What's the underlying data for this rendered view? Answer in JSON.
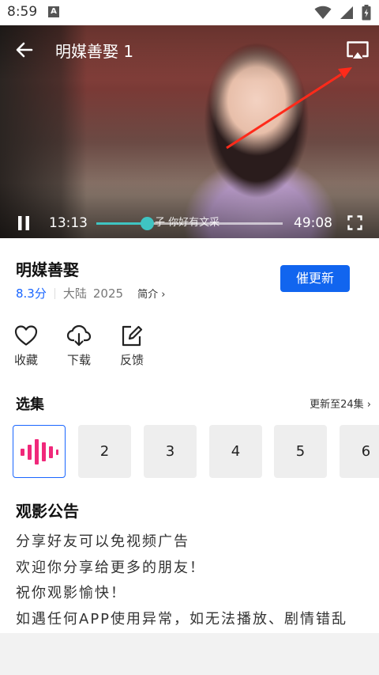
{
  "status_bar": {
    "time": "8:59",
    "notification_icon": "A",
    "icons": [
      "wifi-icon",
      "signal-icon",
      "battery-charging-icon"
    ]
  },
  "player": {
    "title": "明媒善娶 1",
    "subtitle": "子 你好有文采",
    "current_time": "13:13",
    "total_time": "49:08",
    "progress": 0.27,
    "accent_color": "#3fc4c2",
    "annotation_color": "#ff2a1a"
  },
  "show": {
    "title": "明媒善娶",
    "rating": "8.3分",
    "region": "大陆",
    "year": "2025",
    "intro_label": "简介 ›",
    "urge_update_label": "催更新"
  },
  "actions": [
    {
      "label": "收藏",
      "icon": "heart-icon"
    },
    {
      "label": "下载",
      "icon": "cloud-download-icon"
    },
    {
      "label": "反馈",
      "icon": "edit-icon"
    }
  ],
  "episodes_section": {
    "title": "选集",
    "update_info": "更新至24集 ›",
    "current_icon": "playing-bars-icon",
    "items": [
      "2",
      "3",
      "4",
      "5",
      "6"
    ]
  },
  "notice": {
    "title": "观影公告",
    "lines": [
      "分享好友可以免视频广告",
      "欢迎你分享给更多的朋友！",
      "祝你观影愉快！",
      "如遇任何APP使用异常，如无法播放、剧情错乱"
    ]
  },
  "colors": {
    "primary": "#1165ef",
    "rating": "#1a66ff",
    "playing_bars": "#f0287a"
  }
}
